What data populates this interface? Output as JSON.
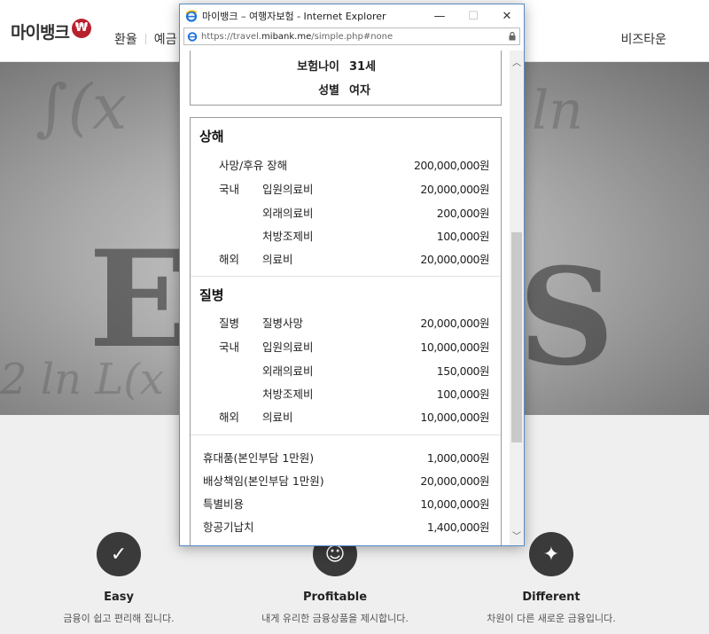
{
  "site": {
    "logo_text": "마이뱅크",
    "logo_badge": "₩",
    "nav": [
      "환율",
      "예금"
    ],
    "nav_right": "비즈타운"
  },
  "features": [
    {
      "icon": "check-icon",
      "title": "Easy",
      "desc": "금융이 쉽고 편리해 집니다."
    },
    {
      "icon": "smile-icon",
      "title": "Profitable",
      "desc": "내게 유리한 금융상품을 제시합니다."
    },
    {
      "icon": "sparkle-icon",
      "title": "Different",
      "desc": "차원이 다른 새로운 금융입니다."
    }
  ],
  "ie": {
    "title": "마이뱅크 – 여행자보험 - Internet Explorer",
    "url_prefix": "https://travel.",
    "url_host": "mibank.me",
    "url_suffix": "/simple.php#none",
    "controls": {
      "minimize": "—",
      "maximize": "☐",
      "close": "✕"
    }
  },
  "profile": {
    "age_label": "보험나이",
    "age_value": "31세",
    "gender_label": "성별",
    "gender_value": "여자"
  },
  "coverage": {
    "injury": {
      "title": "상해",
      "rows": [
        {
          "c1": "사망/후유 장해",
          "c2": "",
          "amount": "200,000,000원"
        },
        {
          "c1": "국내",
          "c2": "입원의료비",
          "amount": "20,000,000원"
        },
        {
          "c1": "",
          "c2": "외래의료비",
          "amount": "200,000원"
        },
        {
          "c1": "",
          "c2": "처방조제비",
          "amount": "100,000원"
        },
        {
          "c1": "해외",
          "c2": "의료비",
          "amount": "20,000,000원"
        }
      ]
    },
    "disease": {
      "title": "질병",
      "rows": [
        {
          "c1": "질병",
          "c2": "질병사망",
          "amount": "20,000,000원"
        },
        {
          "c1": "국내",
          "c2": "입원의료비",
          "amount": "10,000,000원"
        },
        {
          "c1": "",
          "c2": "외래의료비",
          "amount": "150,000원"
        },
        {
          "c1": "",
          "c2": "처방조제비",
          "amount": "100,000원"
        },
        {
          "c1": "해외",
          "c2": "의료비",
          "amount": "10,000,000원"
        }
      ]
    },
    "other": [
      {
        "label": "휴대품(본인부담 1만원)",
        "amount": "1,000,000원"
      },
      {
        "label": "배상책임(본인부담 1만원)",
        "amount": "20,000,000원"
      },
      {
        "label": "특별비용",
        "amount": "10,000,000원"
      },
      {
        "label": "항공기납치",
        "amount": "1,400,000원"
      }
    ]
  }
}
